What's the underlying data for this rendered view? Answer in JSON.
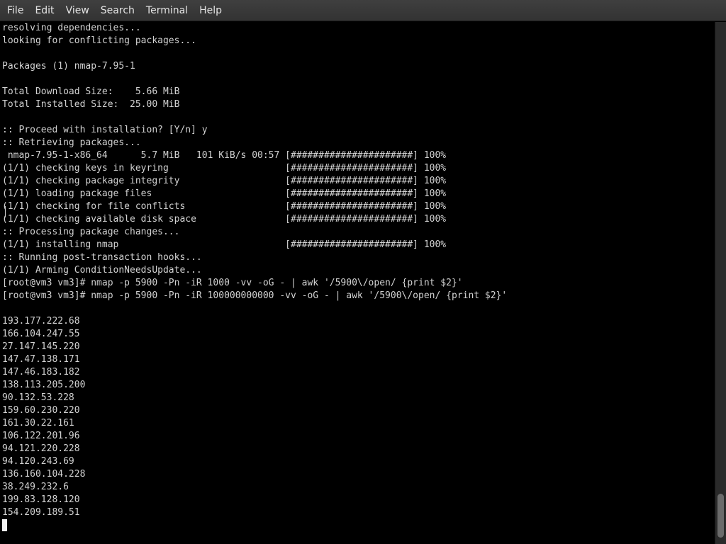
{
  "menu": {
    "items": [
      "File",
      "Edit",
      "View",
      "Search",
      "Terminal",
      "Help"
    ]
  },
  "terminal": {
    "lines": [
      "resolving dependencies...",
      "looking for conflicting packages...",
      "",
      "Packages (1) nmap-7.95-1",
      "",
      "Total Download Size:    5.66 MiB",
      "Total Installed Size:  25.00 MiB",
      "",
      ":: Proceed with installation? [Y/n] y",
      ":: Retrieving packages...",
      " nmap-7.95-1-x86_64      5.7 MiB   101 KiB/s 00:57 [######################] 100%",
      "(1/1) checking keys in keyring                     [######################] 100%",
      "(1/1) checking package integrity                   [######################] 100%",
      "(1/1) loading package files                        [######################] 100%",
      "(1/1) checking for file conflicts                  [######################] 100%",
      "(1/1) checking available disk space                [######################] 100%",
      ":: Processing package changes...",
      "(1/1) installing nmap                              [######################] 100%",
      ":: Running post-transaction hooks...",
      "(1/1) Arming ConditionNeedsUpdate...",
      "[root@vm3 vm3]# nmap -p 5900 -Pn -iR 1000 -vv -oG - | awk '/5900\\/open/ {print $2}'",
      "[root@vm3 vm3]# nmap -p 5900 -Pn -iR 100000000000 -vv -oG - | awk '/5900\\/open/ {print $2}'",
      "",
      "193.177.222.68",
      "166.104.247.55",
      "27.147.145.220",
      "147.47.138.171",
      "147.46.183.182",
      "138.113.205.200",
      "90.132.53.228",
      "159.60.230.220",
      "161.30.22.161",
      "106.122.201.96",
      "94.121.220.228",
      "94.120.243.69",
      "136.160.104.228",
      "38.249.232.6",
      "199.83.128.120",
      "154.209.189.51"
    ]
  },
  "colors": {
    "background": "#000000",
    "text": "#d2d2d2",
    "menubar": "#3a3a3a"
  }
}
